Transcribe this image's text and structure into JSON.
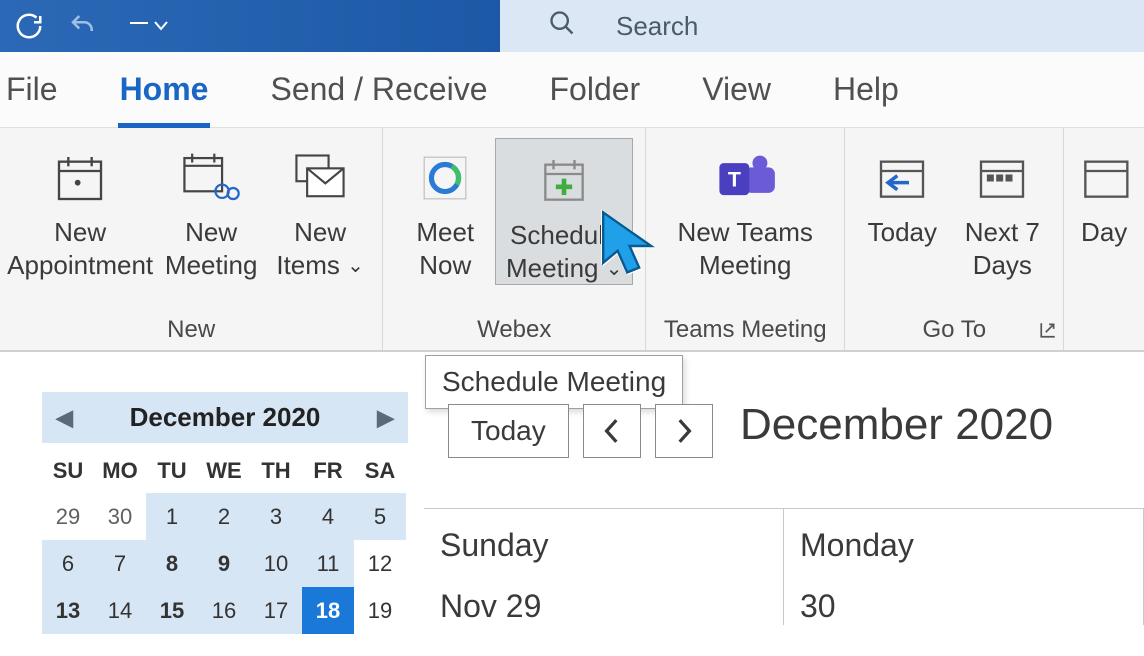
{
  "titlebar": {
    "search_placeholder": "Search"
  },
  "tabs": {
    "file": "File",
    "home": "Home",
    "send_receive": "Send / Receive",
    "folder": "Folder",
    "view": "View",
    "help": "Help"
  },
  "ribbon": {
    "new_appointment": "New\nAppointment",
    "new_meeting": "New\nMeeting",
    "new_items": "New\nItems",
    "meet_now": "Meet\nNow",
    "schedule_meeting_l1": "Schedule",
    "schedule_meeting_l2": "Meeting",
    "new_teams_meeting": "New Teams\nMeeting",
    "today": "Today",
    "next7": "Next 7\nDays",
    "day": "Day",
    "group_new": "New",
    "group_webex": "Webex",
    "group_teams": "Teams Meeting",
    "group_goto": "Go To"
  },
  "tooltip": "Schedule Meeting",
  "minical": {
    "title": "December 2020",
    "weekdays": [
      "SU",
      "MO",
      "TU",
      "WE",
      "TH",
      "FR",
      "SA"
    ],
    "rows": [
      [
        "29",
        "30",
        "1",
        "2",
        "3",
        "4",
        "5"
      ],
      [
        "6",
        "7",
        "8",
        "9",
        "10",
        "11",
        "12"
      ],
      [
        "13",
        "14",
        "15",
        "16",
        "17",
        "18",
        "19"
      ]
    ],
    "today": "18",
    "bold_days": [
      "8",
      "9",
      "13",
      "15"
    ],
    "prev_month_days": [
      "29",
      "30"
    ],
    "outside_days": [
      "19",
      "12"
    ]
  },
  "main": {
    "today_btn": "Today",
    "heading": "December 2020",
    "col1_day": "Sunday",
    "col1_date": "Nov 29",
    "col2_day": "Monday",
    "col2_date": "30"
  }
}
